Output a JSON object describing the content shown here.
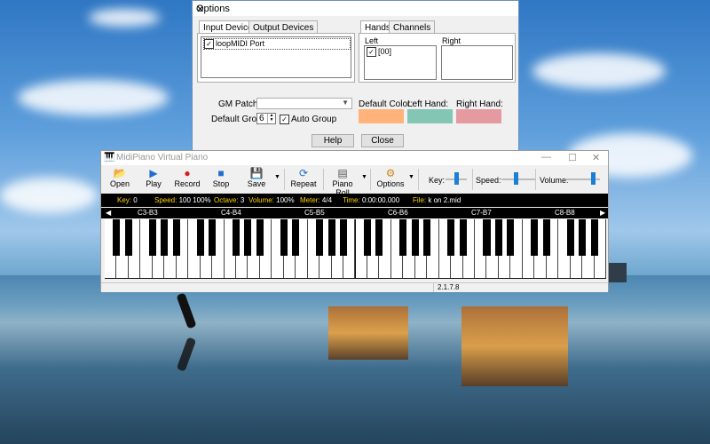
{
  "options_dialog": {
    "title": "Options",
    "tabs_left": [
      "Input Devices",
      "Output Devices"
    ],
    "tabs_right": [
      "Hands",
      "Channels"
    ],
    "input_devices": [
      {
        "label": "loopMIDI Port",
        "checked": true
      }
    ],
    "hands": {
      "left_label": "Left",
      "right_label": "Right",
      "left_items": [
        {
          "label": "[00]",
          "checked": true
        }
      ]
    },
    "gm_patches_label": "GM Patches:",
    "gm_patches_value": "",
    "default_group_label": "Default Group:",
    "default_group_value": "6",
    "auto_group_label": "Auto Group",
    "default_color_label": "Default Color:",
    "left_hand_label": "Left Hand:",
    "right_hand_label": "Right Hand:",
    "colors": {
      "default": "#ffb37a",
      "left_hand": "#84c6b4",
      "right_hand": "#e49aa0"
    },
    "help_button": "Help",
    "close_button": "Close"
  },
  "piano_window": {
    "title": "MidiPiano Virtual Piano",
    "toolbar": {
      "open": "Open",
      "play": "Play",
      "record": "Record",
      "stop": "Stop",
      "save": "Save",
      "repeat": "Repeat",
      "piano_roll": "Piano Roll",
      "options": "Options",
      "key_label": "Key:",
      "speed_label": "Speed:",
      "volume_label": "Volume:"
    },
    "status": {
      "key_label": "Key:",
      "key_value": "0",
      "speed_label": "Speed:",
      "speed_value": "100  100%",
      "octave_label": "Octave:",
      "octave_value": "3",
      "volume_label": "Volume:",
      "volume_value": "100%",
      "meter_label": "Meter:",
      "meter_value": "4/4",
      "time_label": "Time:",
      "time_value": "0:00:00.000",
      "file_label": "File:",
      "file_value": "k on 2.mid"
    },
    "octaves": [
      "C3-B3",
      "C4-B4",
      "C5-B5",
      "C6-B6",
      "C7-B7",
      "C8-B8"
    ],
    "white_key_count": 42,
    "version": "2.1.7.8"
  }
}
